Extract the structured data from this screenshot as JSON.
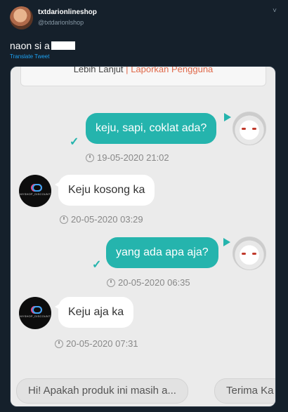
{
  "tweet": {
    "display_name": "txtdarionlineshop",
    "handle": "@txtdarionlshop",
    "caret": "˅",
    "text": "naon si a",
    "translate": "Translate Tweet"
  },
  "screenshot": {
    "top_card": {
      "more": "Lebih Lanjut",
      "separator": "|",
      "report": "Laporkan Pengguna"
    },
    "shop_avatar_text": "MYSHOP_DISCOUNT",
    "messages": [
      {
        "side": "out",
        "text": "keju, sapi, coklat ada?",
        "time": "19-05-2020 21:02",
        "read_check": "✓"
      },
      {
        "side": "in",
        "text": "Keju kosong ka",
        "time": "20-05-2020 03:29"
      },
      {
        "side": "out",
        "text": "yang ada apa aja?",
        "time": "20-05-2020 06:35",
        "read_check": "✓"
      },
      {
        "side": "in",
        "text": "Keju aja ka",
        "time": "20-05-2020 07:31"
      }
    ],
    "quick_replies": [
      "Hi! Apakah produk ini masih a...",
      "Terima Ka"
    ]
  }
}
